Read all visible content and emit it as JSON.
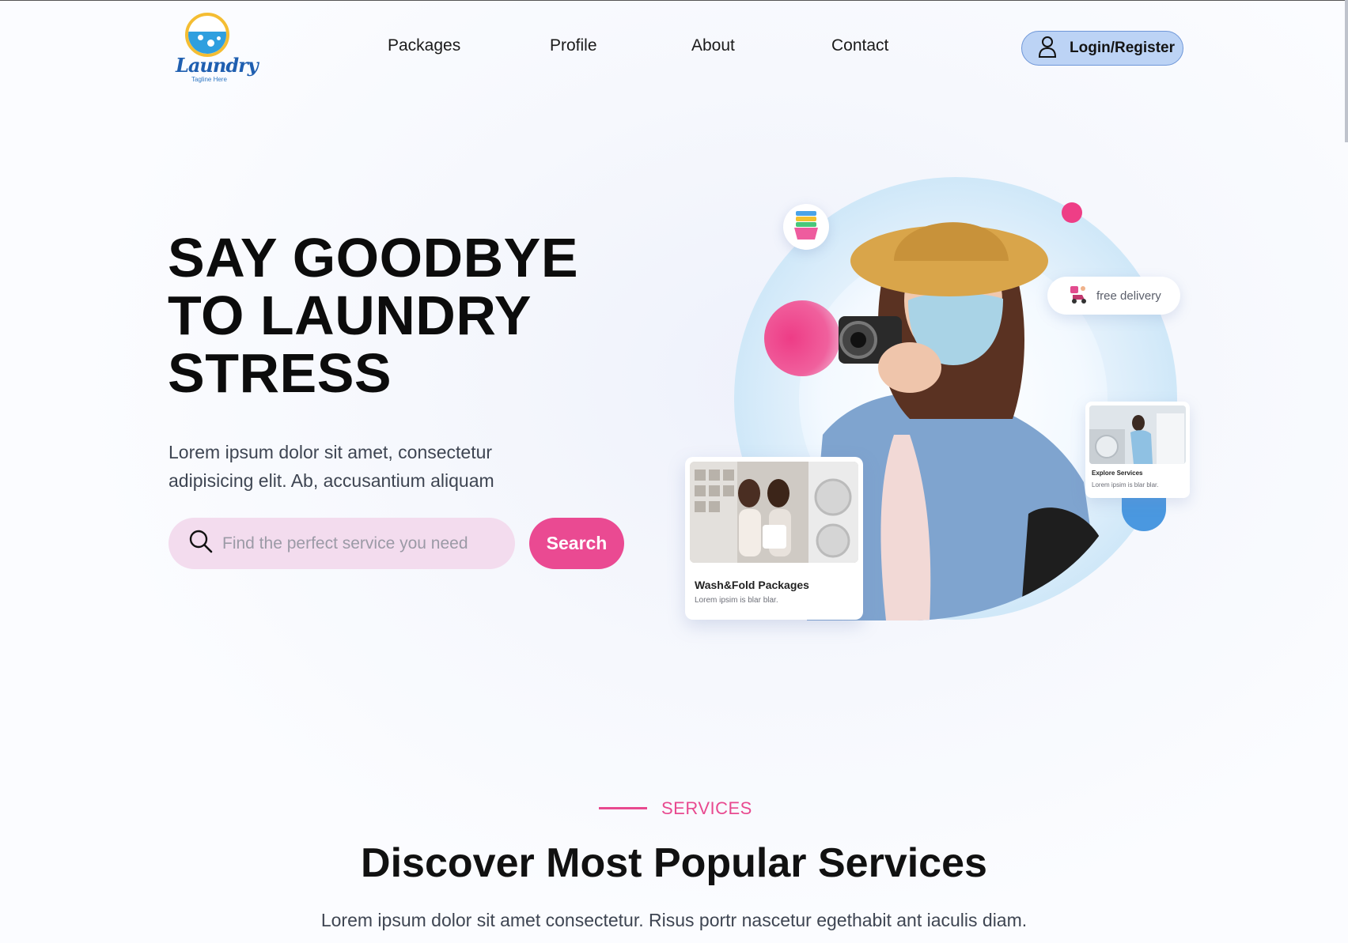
{
  "brand": {
    "name": "Laundry",
    "tagline": "Tagline Here"
  },
  "nav": {
    "items": [
      {
        "label": "Packages"
      },
      {
        "label": "Profile"
      },
      {
        "label": "About"
      },
      {
        "label": "Contact"
      }
    ],
    "login_label": "Login/Register"
  },
  "hero": {
    "title_lines": [
      "SAY GOODBYE",
      "TO LAUNDRY",
      "STRESS"
    ],
    "description": "Lorem ipsum dolor sit amet, consectetur adipisicing elit. Ab, accusantium aliquam",
    "search": {
      "placeholder": "Find the perfect service you need",
      "value": "",
      "button_label": "Search"
    }
  },
  "visual": {
    "delivery_badge": "free delivery",
    "card_main": {
      "title": "Wash&Fold Packages",
      "subtitle": "Lorem ipsim is blar blar."
    },
    "card_explore": {
      "title": "Explore Services",
      "subtitle": "Lorem ipsim is blar blar."
    }
  },
  "services": {
    "eyebrow": "SERVICES",
    "title": "Discover Most Popular Services",
    "description": "Lorem ipsum dolor sit amet consectetur. Risus portr nascetur egethabit ant iaculis diam."
  },
  "colors": {
    "accent": "#ea4a92",
    "login_bg": "#bcd3f5",
    "search_bg": "#f3dcee",
    "logo_ring": "#f4bd32",
    "logo_water": "#2f9fdf"
  },
  "icons": [
    "user-icon",
    "search-icon",
    "basket-icon",
    "scooter-icon"
  ]
}
